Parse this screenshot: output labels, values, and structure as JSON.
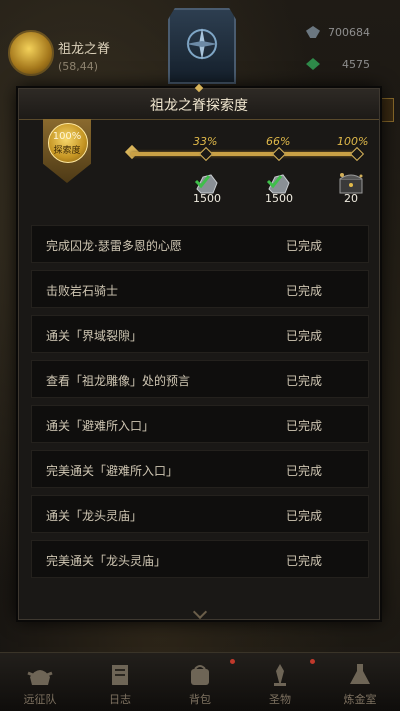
{
  "hud": {
    "zone_name": "祖龙之脊",
    "coords": "(58,44)",
    "resource_1": "700684",
    "resource_2": "4575"
  },
  "panel": {
    "title": "祖龙之脊探索度",
    "progress_percent": "100%",
    "badge_label": "探索度",
    "milestones": [
      {
        "label": "33%",
        "reward_count": "1500",
        "claimed": true
      },
      {
        "label": "66%",
        "reward_count": "1500",
        "claimed": true
      },
      {
        "label": "100%",
        "reward_count": "20",
        "claimed": false
      }
    ],
    "tasks": [
      {
        "text": "完成囚龙·瑟雷多恩的心愿",
        "status": "已完成"
      },
      {
        "text": "击败岩石骑士",
        "status": "已完成"
      },
      {
        "text": "通关「界域裂隙」",
        "status": "已完成"
      },
      {
        "text": "查看「祖龙雕像」处的预言",
        "status": "已完成"
      },
      {
        "text": "通关「避难所入口」",
        "status": "已完成"
      },
      {
        "text": "完美通关「避难所入口」",
        "status": "已完成"
      },
      {
        "text": "通关「龙头灵庙」",
        "status": "已完成"
      },
      {
        "text": "完美通关「龙头灵庙」",
        "status": "已完成"
      }
    ]
  },
  "nav": {
    "items": [
      {
        "label": "远征队",
        "icon": "helmet-icon"
      },
      {
        "label": "日志",
        "icon": "journal-icon"
      },
      {
        "label": "背包",
        "icon": "backpack-icon"
      },
      {
        "label": "圣物",
        "icon": "relic-icon"
      },
      {
        "label": "炼金室",
        "icon": "alchemy-icon"
      }
    ]
  },
  "colors": {
    "accent": "#d8b45a",
    "text": "#cfc6b3",
    "panel": "#1a1816"
  }
}
